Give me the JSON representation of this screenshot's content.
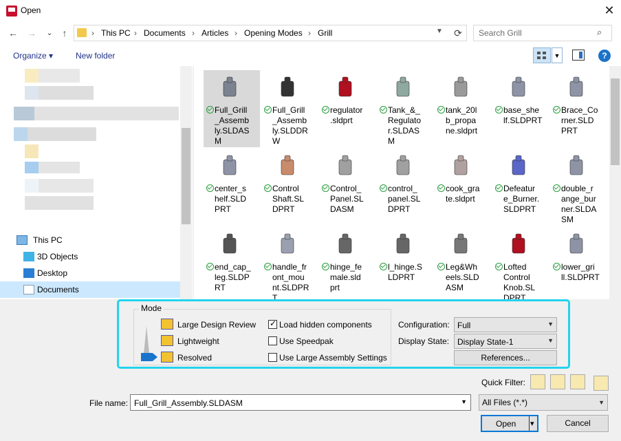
{
  "window": {
    "title": "Open",
    "close_glyph": "✕"
  },
  "nav": {
    "back": "←",
    "forward": "→",
    "recent": "⌄",
    "up": "↑"
  },
  "breadcrumb": [
    "This PC",
    "Documents",
    "Articles",
    "Opening Modes",
    "Grill"
  ],
  "search": {
    "placeholder": "Search Grill"
  },
  "toolbar": {
    "organize": "Organize ▾",
    "new_folder": "New folder",
    "help": "?"
  },
  "navpane": {
    "items": [
      {
        "label": "This PC",
        "icon": "computer-icon"
      },
      {
        "label": "3D Objects",
        "icon": "cube-icon"
      },
      {
        "label": "Desktop",
        "icon": "desktop-icon"
      },
      {
        "label": "Documents",
        "icon": "documents-icon",
        "selected": true
      }
    ]
  },
  "files": [
    {
      "name": "Full_Grill_Assembly.SLDASM",
      "lines": [
        "Full_Grill",
        "_Assemb",
        "ly.SLDAS",
        "M"
      ],
      "selected": true,
      "color": "#7b8290"
    },
    {
      "name": "Full_Grill_Assembly.SLDDRW",
      "lines": [
        "Full_Grill",
        "_Assemb",
        "ly.SLDDR",
        "W"
      ],
      "color": "#333333"
    },
    {
      "name": "regulator.sldprt",
      "lines": [
        "regulator",
        ".sldprt"
      ],
      "color": "#b01020"
    },
    {
      "name": "Tank_&_Regulator.SLDASM",
      "lines": [
        "Tank_&_",
        "Regulato",
        "r.SLDAS",
        "M"
      ],
      "color": "#8fa8a0"
    },
    {
      "name": "tank_20lb_propane.sldprt",
      "lines": [
        "tank_20l",
        "b_propa",
        "ne.sldprt"
      ],
      "color": "#9a9a9a"
    },
    {
      "name": "base_shelf.SLDPRT",
      "lines": [
        "base_she",
        "lf.SLDPRT"
      ],
      "color": "#8e94a6"
    },
    {
      "name": "Brace_Corner.SLDPRT",
      "lines": [
        "Brace_Co",
        "rner.SLD",
        "PRT"
      ],
      "color": "#8e94a6"
    },
    {
      "name": "center_shelf.SLDPRT",
      "lines": [
        "center_s",
        "helf.SLD",
        "PRT"
      ],
      "color": "#8e94a6"
    },
    {
      "name": "Control Shaft.SLDPRT",
      "lines": [
        "Control",
        "Shaft.SL",
        "DPRT"
      ],
      "color": "#c98b6c"
    },
    {
      "name": "Control_Panel.SLDASM",
      "lines": [
        "Control_",
        "Panel.SL",
        "DASM"
      ],
      "color": "#a0a0a0"
    },
    {
      "name": "control_panel.SLDPRT",
      "lines": [
        "control_",
        "panel.SL",
        "DPRT"
      ],
      "color": "#a0a0a0"
    },
    {
      "name": "cook_grate.sldprt",
      "lines": [
        "cook_gra",
        "te.sldprt"
      ],
      "color": "#b0a0a0"
    },
    {
      "name": "Defeature_Burner.SLDPRT",
      "lines": [
        "Defeatur",
        "e_Burner.",
        "SLDPRT"
      ],
      "color": "#5a66c8"
    },
    {
      "name": "double_range_burner.SLDASM",
      "lines": [
        "double_r",
        "ange_bur",
        "ner.SLDA",
        "SM"
      ],
      "color": "#8e94a6"
    },
    {
      "name": "end_cap_leg.SLDPRT",
      "lines": [
        "end_cap_",
        "leg.SLDP",
        "RT"
      ],
      "color": "#555555"
    },
    {
      "name": "handle_front_mount.SLDPRT",
      "lines": [
        "handle_fr",
        "ont_mou",
        "nt.SLDPR",
        "T"
      ],
      "color": "#9aa0b0"
    },
    {
      "name": "hinge_female.sldprt",
      "lines": [
        "hinge_fe",
        "male.sld",
        "prt"
      ],
      "color": "#666666"
    },
    {
      "name": "l_hinge.SLDPRT",
      "lines": [
        "l_hinge.S",
        "LDPRT"
      ],
      "color": "#666666"
    },
    {
      "name": "Leg&Wheels.SLDASM",
      "lines": [
        "Leg&Wh",
        "eels.SLD",
        "ASM"
      ],
      "color": "#777777"
    },
    {
      "name": "Lofted Control Knob.SLDPRT",
      "lines": [
        "Lofted",
        "Control",
        "Knob.SL",
        "DPRT"
      ],
      "color": "#b01020"
    },
    {
      "name": "lower_grill.SLDPRT",
      "lines": [
        "lower_gri",
        "ll.SLDPRT"
      ],
      "color": "#8e94a6"
    }
  ],
  "mode": {
    "legend": "Mode",
    "options": [
      "Large Design Review",
      "Lightweight",
      "Resolved"
    ],
    "checkboxes": [
      {
        "label": "Load hidden components",
        "checked": true
      },
      {
        "label": "Use Speedpak",
        "checked": false
      },
      {
        "label": "Use Large Assembly Settings",
        "checked": false
      }
    ],
    "configuration_label": "Configuration:",
    "configuration_value": "Full",
    "display_state_label": "Display State:",
    "display_state_value": "Display State-1",
    "references_button": "References..."
  },
  "quick_filter": {
    "label": "Quick Filter:"
  },
  "file_name": {
    "label": "File name:",
    "value": "Full_Grill_Assembly.SLDASM"
  },
  "file_type": {
    "value": "All Files (*.*)"
  },
  "buttons": {
    "open": "Open",
    "open_arrow": "▾",
    "cancel": "Cancel"
  },
  "colors": {
    "accent": "#0078d7",
    "highlight": "#22d3ee",
    "check": "#2a9d3e"
  }
}
